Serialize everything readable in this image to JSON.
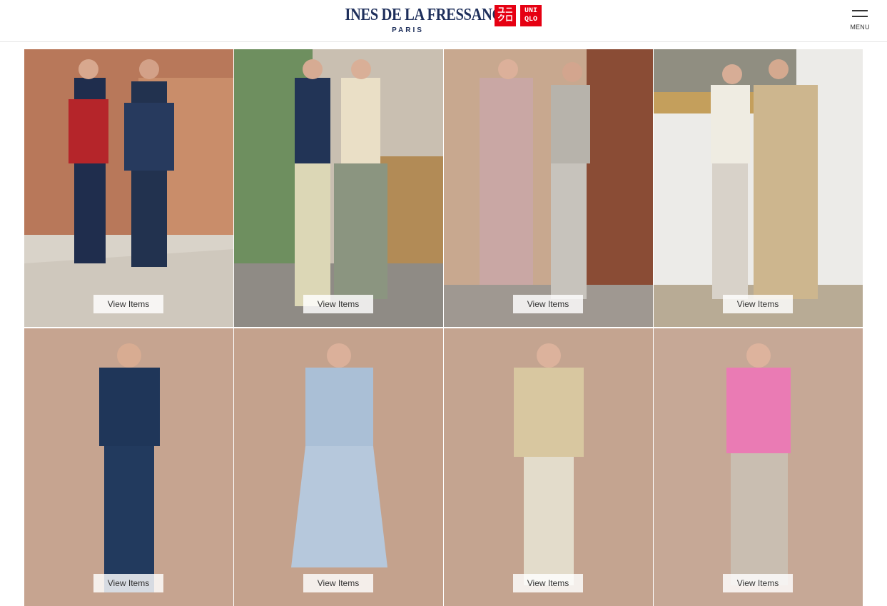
{
  "header": {
    "brand_name": "INES DE LA FRESSANGE",
    "brand_city": "PARIS",
    "uniqlo_logo_left": "ユニクロ",
    "uniqlo_logo_right_top": "UNI",
    "uniqlo_logo_right_bottom": "QLO",
    "menu_label": "MENU",
    "accent_color": "#e60012",
    "brand_color": "#1e2f5b"
  },
  "looks": [
    {
      "button": "View Items"
    },
    {
      "button": "View Items"
    },
    {
      "button": "View Items"
    },
    {
      "button": "View Items"
    },
    {
      "button": "View Items"
    },
    {
      "button": "View Items"
    },
    {
      "button": "View Items"
    },
    {
      "button": "View Items"
    }
  ]
}
